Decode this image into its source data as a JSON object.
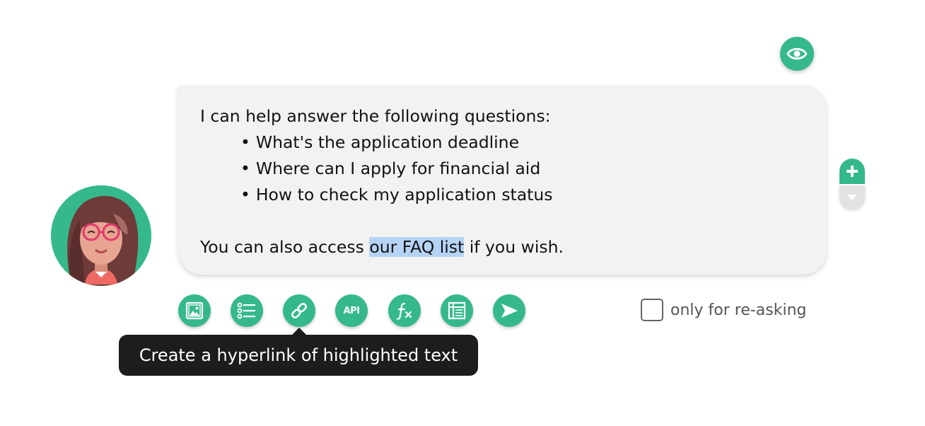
{
  "colors": {
    "accent": "#35b98c",
    "bubble_bg": "#f2f2f2",
    "highlight": "#b5d3f5",
    "tooltip_bg": "#1d1d1d"
  },
  "header": {
    "preview_icon": "eye-icon"
  },
  "message": {
    "intro": "I can help answer the following questions:",
    "items": [
      "What's the application deadline",
      "Where can I apply for financial aid",
      "How to check my application status"
    ],
    "footer_before": "You can also access ",
    "footer_highlight": "our FAQ list",
    "footer_after": " if you wish."
  },
  "stepper": {
    "up_icon": "plus-icon",
    "down_icon": "triangle-down-icon"
  },
  "toolbar": {
    "tools": [
      {
        "icon": "image-icon"
      },
      {
        "icon": "list-icon"
      },
      {
        "icon": "link-icon"
      },
      {
        "icon": "api-icon",
        "label": "API"
      },
      {
        "icon": "function-icon"
      },
      {
        "icon": "table-icon"
      },
      {
        "icon": "send-icon"
      }
    ]
  },
  "reask": {
    "label": "only for re-asking",
    "checked": false
  },
  "tooltip": {
    "text": "Create a hyperlink of highlighted text"
  }
}
